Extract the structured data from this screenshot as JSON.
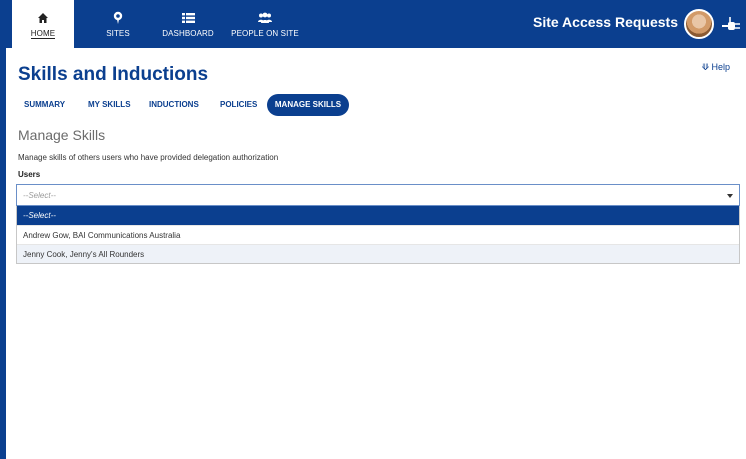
{
  "nav": {
    "items": [
      {
        "label": "HOME",
        "icon": "home-icon"
      },
      {
        "label": "SITES",
        "icon": "map-pin-icon"
      },
      {
        "label": "DASHBOARD",
        "icon": "list-icon"
      },
      {
        "label": "PEOPLE ON SITE",
        "icon": "group-icon"
      }
    ],
    "active_index": 0,
    "app_title": "Site Access Requests"
  },
  "help_label": "Help",
  "page": {
    "title": "Skills and Inductions",
    "tabs": [
      {
        "label": "SUMMARY"
      },
      {
        "label": "MY SKILLS"
      },
      {
        "label": "INDUCTIONS"
      },
      {
        "label": "POLICIES"
      },
      {
        "label": "MANAGE SKILLS"
      }
    ],
    "active_tab": "MANAGE SKILLS",
    "section_title": "Manage Skills",
    "description": "Manage skills of others users who have provided delegation authorization",
    "users_label": "Users",
    "users_select": {
      "value": "--Select--",
      "options": [
        "--Select--",
        "Andrew Gow, BAI Communications Australia",
        "Jenny Cook, Jenny's All Rounders"
      ]
    }
  },
  "colors": {
    "brand": "#0b3f8f",
    "text": "#333333",
    "muted": "#6b6b6b"
  }
}
